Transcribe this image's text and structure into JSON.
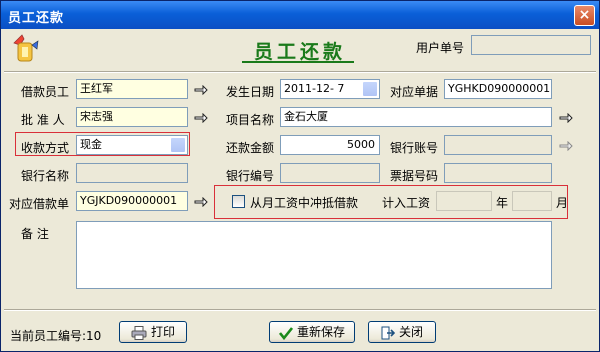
{
  "window": {
    "title": "员工还款",
    "close_label": "×"
  },
  "form": {
    "heading": "员工还款",
    "user_no_label": "用户单号",
    "user_no_value": "",
    "borrower_label": "借款员工",
    "borrower_value": "王红军",
    "date_label": "发生日期",
    "date_value": "2011-12- 7",
    "ref_no_label": "对应单据",
    "ref_no_value": "YGHKD090000001",
    "approver_label": "批 准 人",
    "approver_value": "宋志强",
    "project_label": "项目名称",
    "project_value": "金石大厦",
    "pay_method_label": "收款方式",
    "pay_method_value": "现金",
    "amount_label": "还款金额",
    "amount_value": "5000",
    "bank_account_label": "银行账号",
    "bank_account_value": "",
    "bank_name_label": "银行名称",
    "bank_name_value": "",
    "bank_no_label": "银行编号",
    "bank_no_value": "",
    "invoice_label": "票据号码",
    "invoice_value": "",
    "loan_no_label": "对应借款单",
    "loan_no_value": "YGJKD090000001",
    "offset_label": "从月工资中冲抵借款",
    "offset_checked": false,
    "salary_label": "计入工资",
    "year_label": "年",
    "month_label": "月",
    "remarks_label": "备    注",
    "remarks_value": ""
  },
  "footer": {
    "employee_no_text": "当前员工编号:10",
    "print_label": "打印",
    "resave_label": "重新保存",
    "close_label": "关闭"
  },
  "colors": {
    "accent_green": "#1a7a1a",
    "highlight_red": "#d9303a",
    "required_yellow": "#ffffe1"
  }
}
